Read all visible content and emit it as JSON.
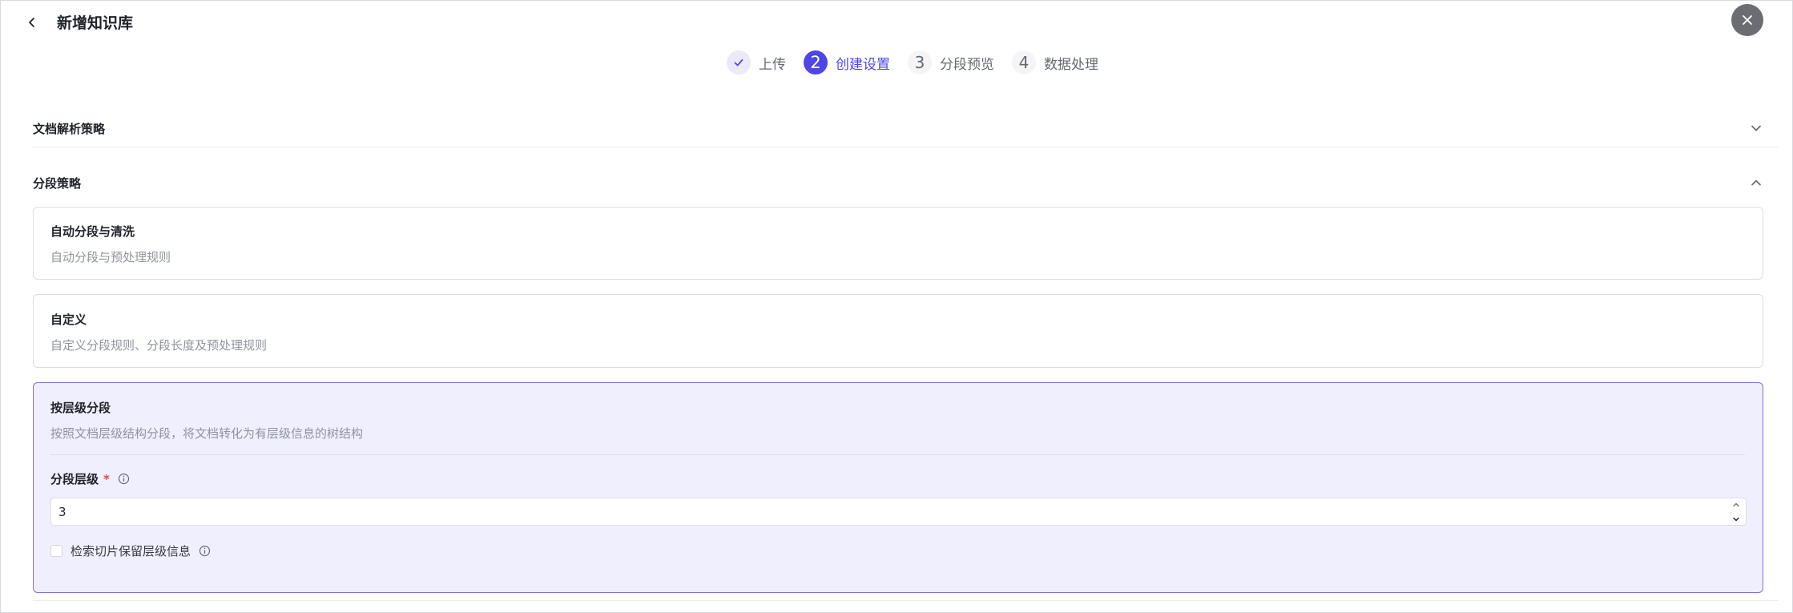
{
  "header": {
    "title": "新增知识库"
  },
  "steps": [
    {
      "number": "",
      "label": "上传",
      "state": "done"
    },
    {
      "number": "2",
      "label": "创建设置",
      "state": "active"
    },
    {
      "number": "3",
      "label": "分段预览",
      "state": "pending"
    },
    {
      "number": "4",
      "label": "数据处理",
      "state": "pending"
    }
  ],
  "sections": {
    "parse": {
      "title": "文档解析策略",
      "expanded": false
    },
    "segment": {
      "title": "分段策略",
      "expanded": true
    }
  },
  "options": {
    "auto": {
      "title": "自动分段与清洗",
      "desc": "自动分段与预处理规则"
    },
    "custom": {
      "title": "自定义",
      "desc": "自定义分段规则、分段长度及预处理规则"
    },
    "hierarchy": {
      "title": "按层级分段",
      "desc": "按照文档层级结构分段，将文档转化为有层级信息的树结构",
      "selected": true,
      "level_label": "分段层级",
      "required_mark": "*",
      "level_value": "3",
      "keep_info_label": "检索切片保留层级信息",
      "keep_info_checked": false
    }
  },
  "colors": {
    "accent": "#4f46e5",
    "selected_bg": "#f0effd",
    "selected_border": "#7a72d8",
    "required": "#e5483f"
  }
}
